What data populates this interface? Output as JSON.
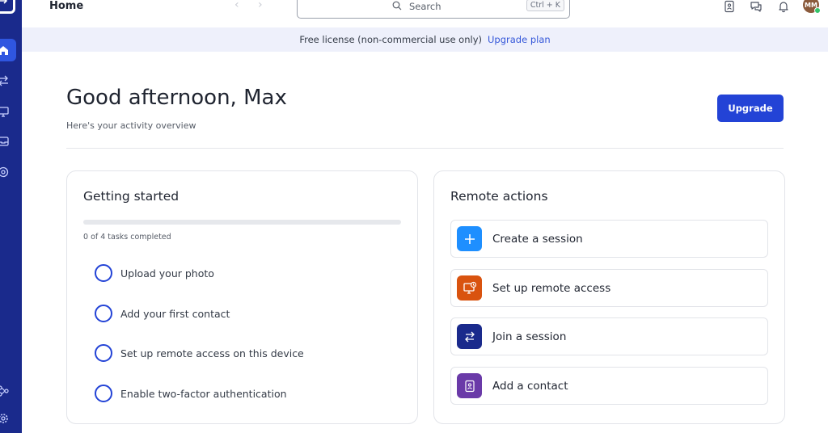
{
  "topbar": {
    "title": "Home",
    "back_arrow": "‹",
    "forward_arrow": "›",
    "search_placeholder": "Search",
    "search_shortcut": "Ctrl + K",
    "avatar_initials": "MM"
  },
  "banner": {
    "text": "Free license (non-commercial use only)",
    "link": "Upgrade plan"
  },
  "header": {
    "greeting": "Good afternoon, Max",
    "subtitle": "Here's your activity overview",
    "upgrade_label": "Upgrade"
  },
  "getting_started": {
    "title": "Getting started",
    "progress_text": "0 of 4 tasks completed",
    "progress": 0,
    "tasks": [
      {
        "label": "Upload your photo"
      },
      {
        "label": "Add your first contact"
      },
      {
        "label": "Set up remote access on this device"
      },
      {
        "label": "Enable two-factor authentication"
      }
    ]
  },
  "remote_actions": {
    "title": "Remote actions",
    "items": [
      {
        "label": "Create a session",
        "icon": "plus-icon",
        "color": "#1e8fff"
      },
      {
        "label": "Set up remote access",
        "icon": "monitor-icon",
        "color": "#d9530f"
      },
      {
        "label": "Join a session",
        "icon": "swap-arrows-icon",
        "color": "#1a2a8c"
      },
      {
        "label": "Add a contact",
        "icon": "contact-icon",
        "color": "#6a3aa8"
      }
    ]
  },
  "colors": {
    "sidebar": "#1a2a8c",
    "accent": "#2343d6",
    "banner_bg": "#eef0fb",
    "link": "#3356d9"
  }
}
